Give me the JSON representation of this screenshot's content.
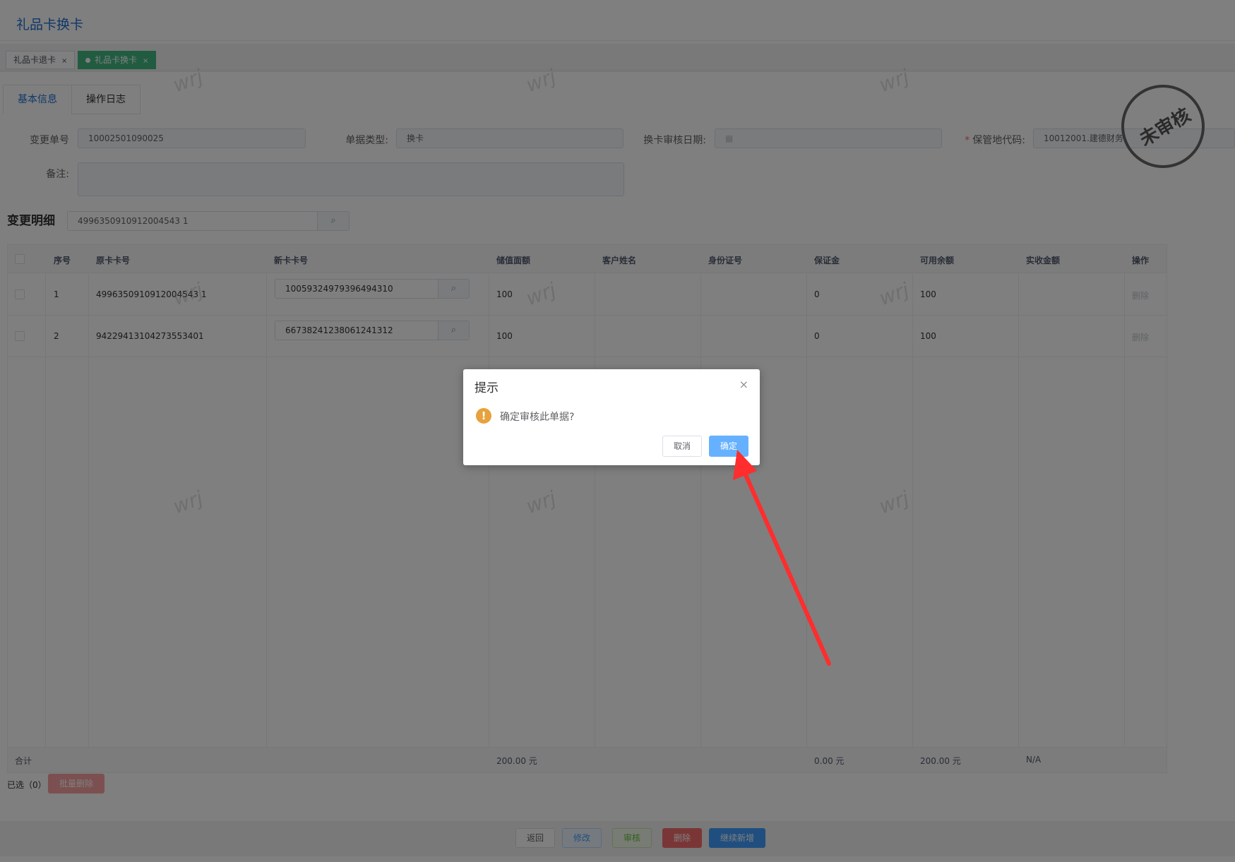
{
  "page": {
    "title": "礼品卡换卡"
  },
  "tags": [
    {
      "label": "礼品卡退卡",
      "close": "×"
    },
    {
      "label": "礼品卡换卡",
      "close": "×"
    }
  ],
  "subtabs": [
    "基本信息",
    "操作日志"
  ],
  "form": {
    "change_no_label": "变更单号",
    "change_no_value": "10002501090025",
    "doc_type_label": "单据类型:",
    "doc_type_value": "换卡",
    "audit_date_label": "换卡审核日期:",
    "audit_date_value": "",
    "storage_label": "保管地代码:",
    "storage_value": "10012001.建德财务",
    "remark_label": "备注:",
    "remark_value": ""
  },
  "stamp": {
    "text": "未审核"
  },
  "detail": {
    "title": "变更明细",
    "search_value": "4996350910912004543 1"
  },
  "table": {
    "headers": [
      "序号",
      "原卡卡号",
      "新卡卡号",
      "储值面额",
      "客户姓名",
      "身份证号",
      "保证金",
      "可用余额",
      "实收金额",
      "操作"
    ],
    "rows": [
      {
        "no": "1",
        "old_card": "4996350910912004543 1",
        "new_card": "10059324979396494310",
        "face": "100",
        "name": "",
        "id": "",
        "deposit": "0",
        "balance": "100",
        "paid": "",
        "op": "删除"
      },
      {
        "no": "2",
        "old_card": "94229413104273553401",
        "new_card": "66738241238061241312",
        "face": "100",
        "name": "",
        "id": "",
        "deposit": "0",
        "balance": "100",
        "paid": "",
        "op": "删除"
      }
    ],
    "footer": {
      "label": "合计",
      "face_total": "200.00 元",
      "deposit_total": "0.00 元",
      "balance_total": "200.00 元",
      "paid_total": "N/A"
    }
  },
  "selection": {
    "selected_text": "已选（0）",
    "batch_delete": "批量删除"
  },
  "footer_buttons": [
    "返回",
    "修改",
    "审核",
    "删除",
    "继续新增"
  ],
  "watermark": "wrj",
  "dialog": {
    "title": "提示",
    "close": "×",
    "message": "确定审核此单据?",
    "cancel": "取消",
    "ok": "确定"
  },
  "colors": {
    "primary": "#1f6fd1",
    "success": "#42b983",
    "danger": "#f56c6c",
    "warning": "#e6a23c",
    "arrow": "#ff2d2d"
  }
}
